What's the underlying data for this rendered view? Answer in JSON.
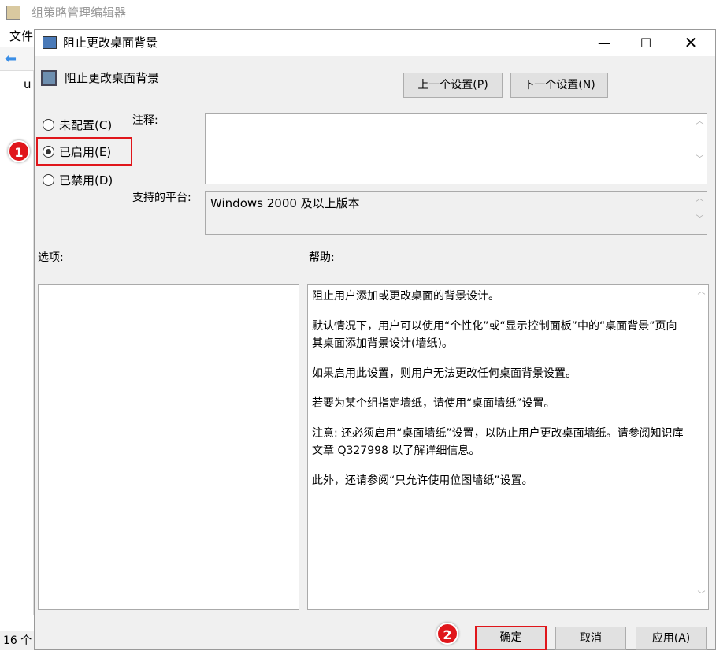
{
  "background_window": {
    "title": "组策略管理编辑器",
    "menu_file": "文件",
    "tree_item": "u",
    "status": "16 个"
  },
  "dialog": {
    "title": "阻止更改桌面背景",
    "policy_name": "阻止更改桌面背景",
    "prev_button": "上一个设置(P)",
    "next_button": "下一个设置(N)",
    "radios": [
      {
        "label": "未配置(C)",
        "checked": false
      },
      {
        "label": "已启用(E)",
        "checked": true
      },
      {
        "label": "已禁用(D)",
        "checked": false
      }
    ],
    "comment_label": "注释:",
    "comment_value": "",
    "platform_label": "支持的平台:",
    "platform_value": "Windows 2000 及以上版本",
    "options_label": "选项:",
    "help_label": "帮助:",
    "help_paragraphs": [
      "阻止用户添加或更改桌面的背景设计。",
      "默认情况下，用户可以使用“个性化”或“显示控制面板”中的“桌面背景”页向其桌面添加背景设计(墙纸)。",
      "如果启用此设置，则用户无法更改任何桌面背景设置。",
      "若要为某个组指定墙纸，请使用“桌面墙纸”设置。",
      "注意: 还必须启用“桌面墙纸”设置，以防止用户更改桌面墙纸。请参阅知识库文章 Q327998 以了解详细信息。",
      "此外，还请参阅“只允许使用位图墙纸”设置。"
    ],
    "ok_button": "确定",
    "cancel_button": "取消",
    "apply_button": "应用(A)"
  },
  "annotations": {
    "step1": "1",
    "step2": "2"
  },
  "colors": {
    "highlight": "#e0161b"
  }
}
